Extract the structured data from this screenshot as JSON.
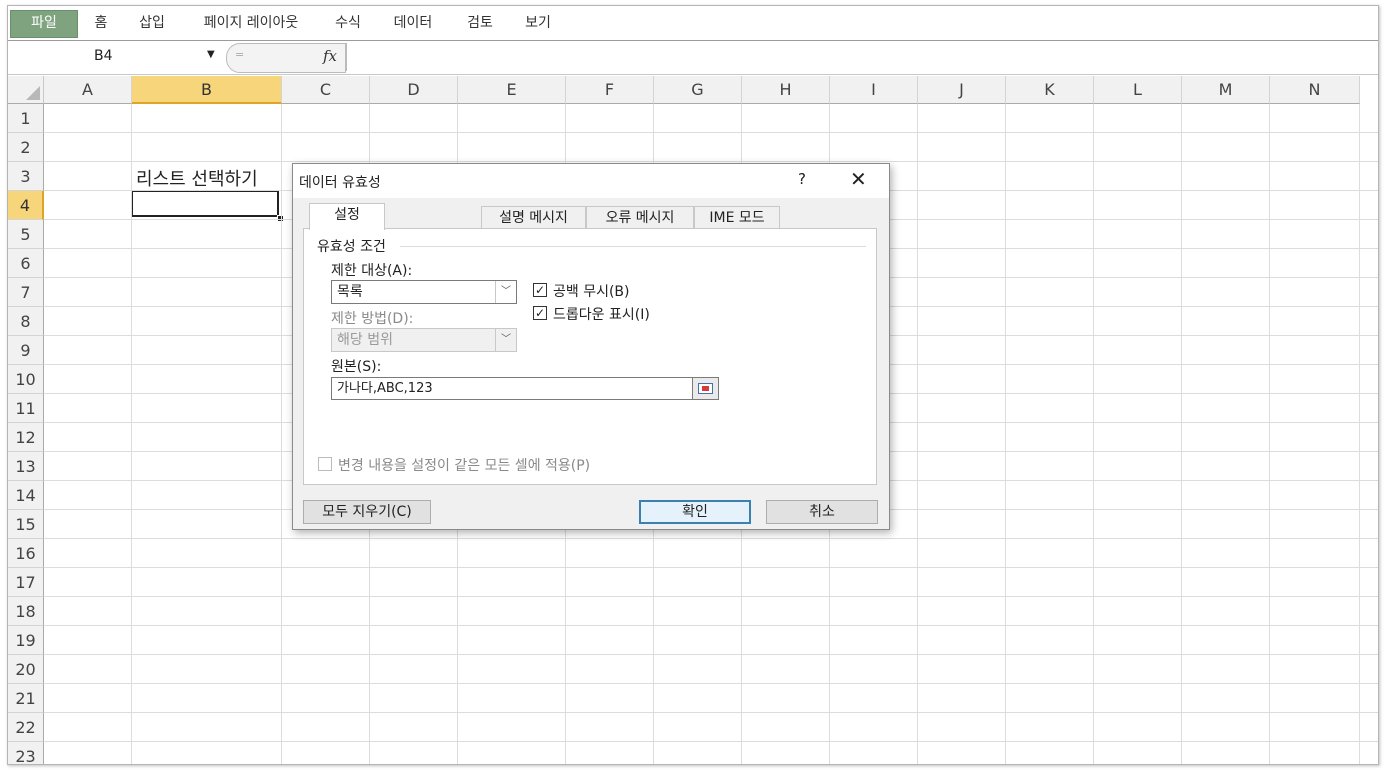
{
  "ribbon": {
    "tabs": [
      "파일",
      "홈",
      "삽입",
      "페이지 레이아웃",
      "수식",
      "데이터",
      "검토",
      "보기"
    ]
  },
  "formula_bar": {
    "name_box": "B4",
    "fx_label": "fx",
    "value": ""
  },
  "sheet": {
    "columns": [
      "A",
      "B",
      "C",
      "D",
      "E",
      "F",
      "G",
      "H",
      "I",
      "J",
      "K",
      "L",
      "M",
      "N"
    ],
    "rows": [
      "1",
      "2",
      "3",
      "4",
      "5",
      "6",
      "7",
      "8",
      "9",
      "10",
      "11",
      "12",
      "13",
      "14",
      "15",
      "16",
      "17",
      "18",
      "19",
      "20",
      "21",
      "22",
      "23"
    ],
    "selected_column": "B",
    "selected_row": "4",
    "cell_b3": "리스트 선택하기"
  },
  "dialog": {
    "title": "데이터 유효성",
    "help": "?",
    "close": "✕",
    "tabs": [
      "설정",
      "설명 메시지",
      "오류 메시지",
      "IME 모드"
    ],
    "active_tab": "설정",
    "group_label": "유효성 조건",
    "allow_label": "제한 대상(A):",
    "allow_value": "목록",
    "data_label": "제한 방법(D):",
    "data_value": "해당 범위",
    "ignore_blank_label": "공백 무시(B)",
    "ignore_blank_checked": true,
    "dropdown_label": "드롭다운 표시(I)",
    "dropdown_checked": true,
    "source_label": "원본(S):",
    "source_value": "가나다,ABC,123",
    "apply_all_label": "변경 내용을 설정이 같은 모든 셀에 적용(P)",
    "apply_all_checked": false,
    "clear_all": "모두 지우기(C)",
    "ok": "확인",
    "cancel": "취소"
  }
}
